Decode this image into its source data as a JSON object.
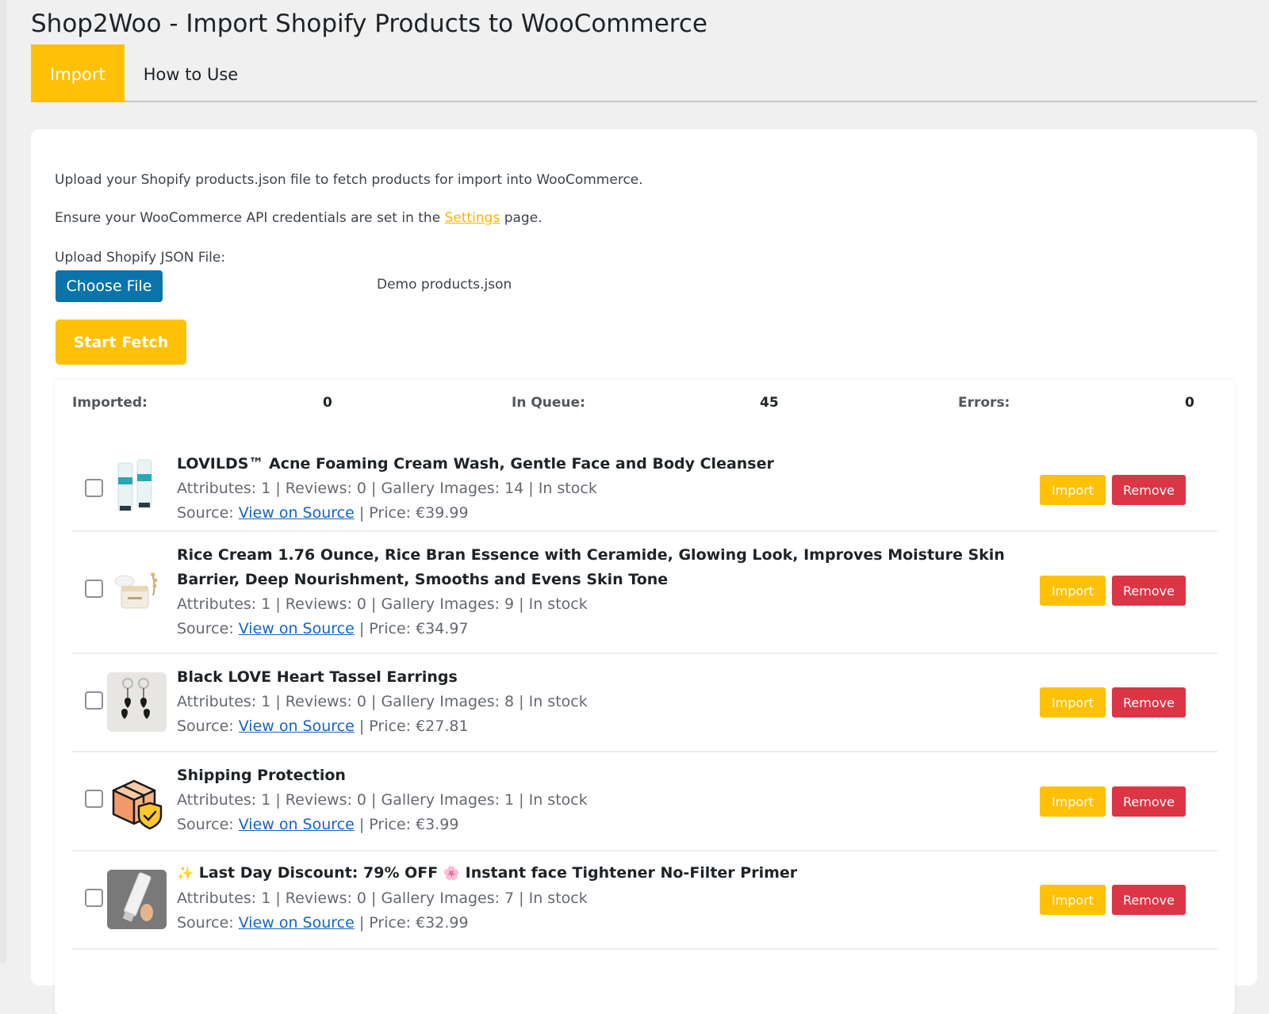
{
  "page": {
    "title": "Shop2Woo - Import Shopify Products to WooCommerce",
    "tabs": [
      {
        "label": "Import",
        "active": true
      },
      {
        "label": "How to Use",
        "active": false
      }
    ]
  },
  "intro": {
    "line1": "Upload your Shopify products.json file to fetch products for import into WooCommerce.",
    "line2_before": "Ensure your WooCommerce API credentials are set in the ",
    "line2_link": "Settings",
    "line2_after": " page."
  },
  "upload": {
    "label": "Upload Shopify JSON File:",
    "choose_label": "Choose File",
    "file_name": "Demo products.json",
    "fetch_label": "Start Fetch"
  },
  "stats": {
    "imported_label": "Imported:",
    "imported_value": "0",
    "queue_label": "In Queue:",
    "queue_value": "45",
    "errors_label": "Errors:",
    "errors_value": "0"
  },
  "labels": {
    "source": "Source:",
    "view_source": "View on Source",
    "import": "Import",
    "remove": "Remove"
  },
  "products": [
    {
      "title": "LOVILDS™ Acne Foaming Cream Wash, Gentle Face and Body Cleanser",
      "meta": "Attributes: 1 | Reviews: 0 | Gallery Images: 14 | In stock",
      "price": "| Price: €39.99"
    },
    {
      "title": "Rice Cream 1.76 Ounce, Rice Bran Essence with Ceramide, Glowing Look, Improves Moisture Skin Barrier, Deep Nourishment, Smooths and Evens Skin Tone",
      "meta": "Attributes: 1 | Reviews: 0 | Gallery Images: 9 | In stock",
      "price": "| Price: €34.97"
    },
    {
      "title": "Black LOVE Heart Tassel Earrings",
      "meta": "Attributes: 1 | Reviews: 0 | Gallery Images: 8 | In stock",
      "price": "| Price: €27.81"
    },
    {
      "title": "Shipping Protection",
      "meta": "Attributes: 1 | Reviews: 0 | Gallery Images: 1 | In stock",
      "price": "| Price: €3.99"
    },
    {
      "title_emoji1": "✨",
      "title_part1": "Last Day Discount: 79% OFF",
      "title_emoji2": "🌸",
      "title_part2": "Instant face Tightener No-Filter Primer",
      "meta": "Attributes: 1 | Reviews: 0 | Gallery Images: 7 | In stock",
      "price": "| Price: €32.99"
    }
  ],
  "colors": {
    "accent": "#ffc107",
    "primary_button": "#0a73aa",
    "danger": "#dc3545",
    "link": "#1565c0"
  }
}
